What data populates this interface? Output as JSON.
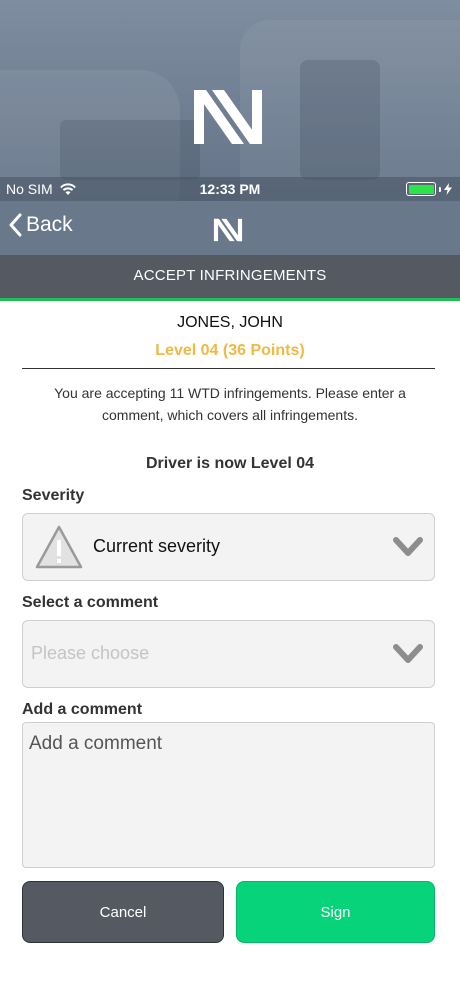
{
  "status_bar": {
    "carrier": "No SIM",
    "time": "12:33 PM",
    "battery_color": "#2ee24a"
  },
  "nav": {
    "back_label": "Back"
  },
  "page": {
    "title": "ACCEPT INFRINGEMENTS"
  },
  "driver": {
    "name": "JONES, JOHN",
    "level": "Level 04 (36 Points)"
  },
  "info_text": "You are accepting 11 WTD infringements. Please enter a comment, which covers all infringements.",
  "now_level": "Driver is now Level 04",
  "severity": {
    "label": "Severity",
    "value": "Current severity",
    "icon": "warning-icon"
  },
  "select_comment": {
    "label": "Select a comment",
    "placeholder": "Please choose"
  },
  "add_comment": {
    "label": "Add a comment",
    "placeholder": "Add a comment"
  },
  "buttons": {
    "cancel": "Cancel",
    "sign": "Sign"
  },
  "colors": {
    "accent_green": "#06d37a",
    "level_gold": "#f0b945",
    "title_bar": "#545962"
  }
}
